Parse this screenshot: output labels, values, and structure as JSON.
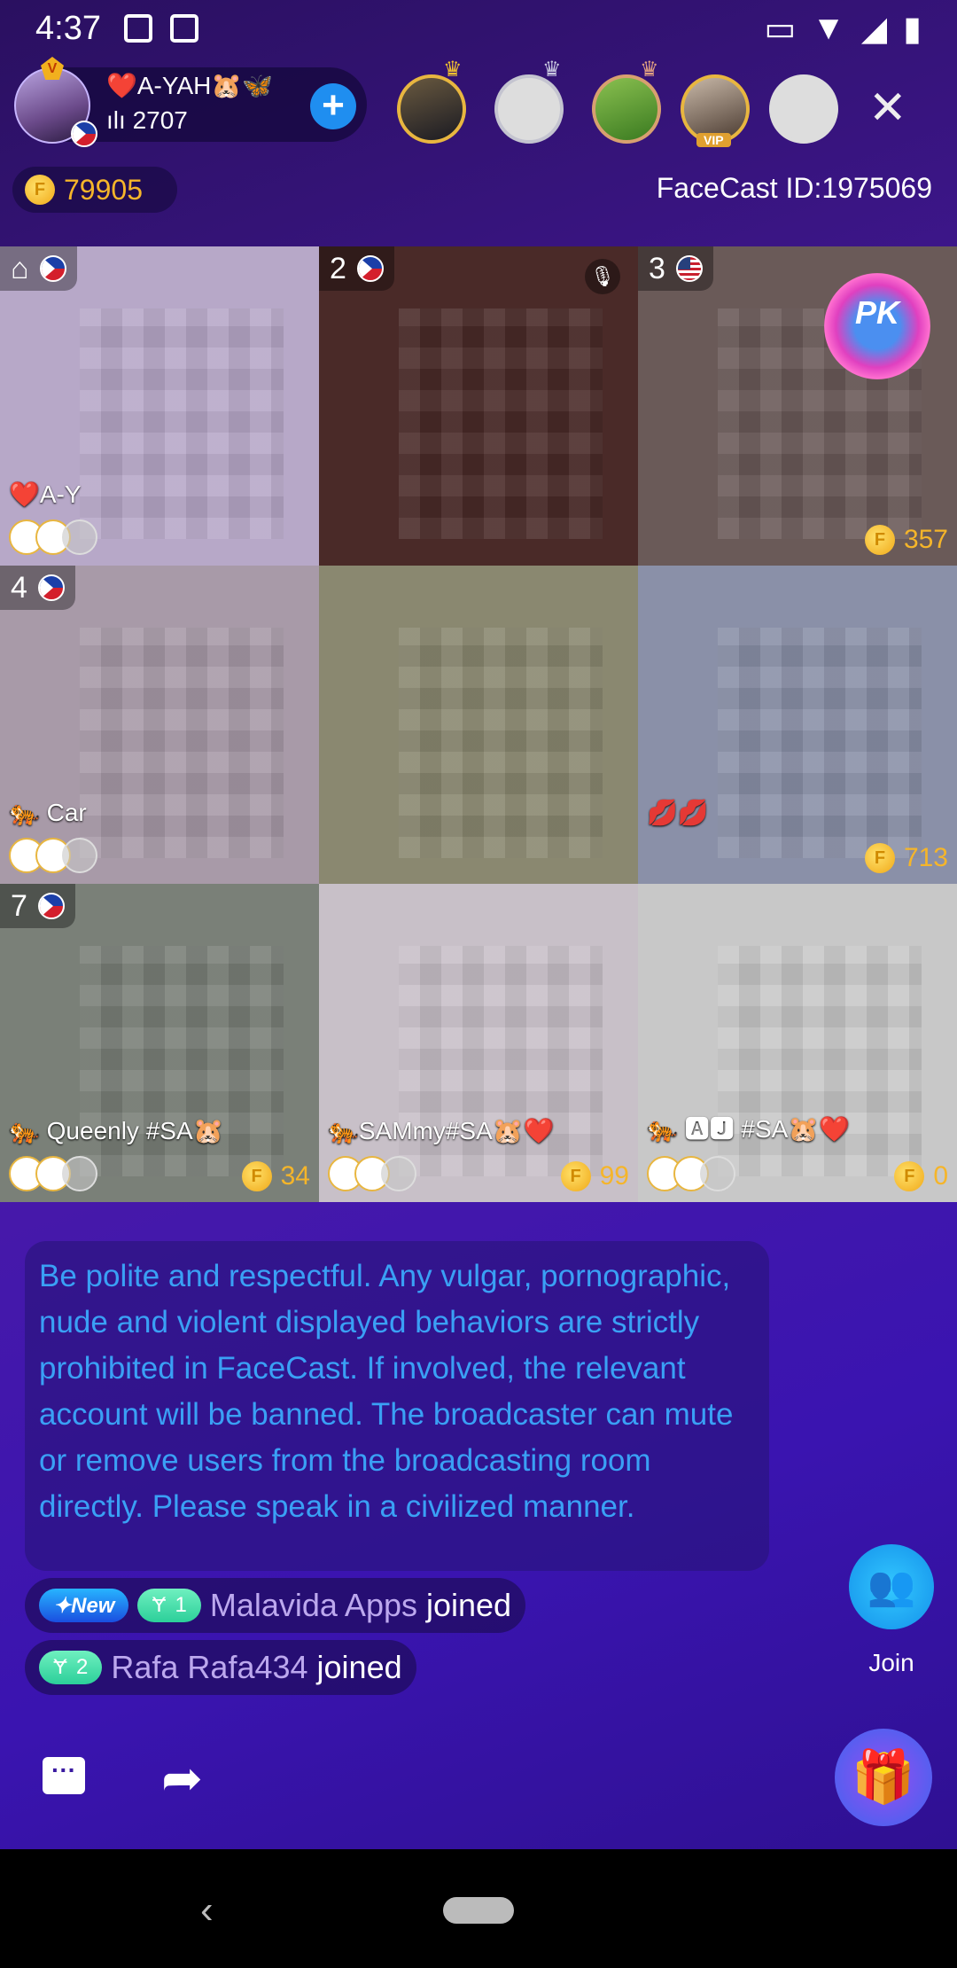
{
  "status_bar": {
    "time": "4:37",
    "icons": [
      "image-icon",
      "screenshot-icon",
      "cast-icon",
      "wifi-icon",
      "signal-icon",
      "battery-icon"
    ]
  },
  "host": {
    "name": "❤️A-YAH🐹🦋",
    "fans": "2707",
    "level_badge": "V",
    "follow_label": "+"
  },
  "viewers": [
    {
      "frame": "gold-crown"
    },
    {
      "frame": "silver-crown"
    },
    {
      "frame": "bronze-crown"
    },
    {
      "frame": "vip",
      "badge": "VIP"
    },
    {
      "frame": "none"
    }
  ],
  "close_label": "✕",
  "coins": "79905",
  "facecast_id": "FaceCast ID:1975069",
  "cells": [
    {
      "seat": "",
      "flag": "ph",
      "name": "❤️A-Y",
      "coins": "",
      "bg": "#b7a8c8",
      "host": true
    },
    {
      "seat": "2",
      "flag": "ph",
      "name": "",
      "coins": "",
      "bg": "#4a2a28",
      "muted": true
    },
    {
      "seat": "3",
      "flag": "us",
      "name": "",
      "coins": "357",
      "bg": "#6a5a58",
      "pk": "PK"
    },
    {
      "seat": "4",
      "flag": "ph",
      "name": "🐅 Car",
      "coins": "",
      "bg": "#a89aa8"
    },
    {
      "seat": "",
      "flag": "",
      "name": "",
      "coins": "",
      "bg": "#8a8870"
    },
    {
      "seat": "",
      "flag": "",
      "name": "💋💋",
      "coins": "713",
      "bg": "#8a90a8"
    },
    {
      "seat": "7",
      "flag": "ph",
      "name": "🐅 Queenly #SA🐹",
      "coins": "34",
      "bg": "#7a8078"
    },
    {
      "seat": "",
      "flag": "",
      "name": "🐅SAMmy#SA🐹❤️",
      "coins": "99",
      "bg": "#c8c0c8"
    },
    {
      "seat": "",
      "flag": "",
      "name": "🐅 🅰🅹 #SA🐹❤️",
      "coins": "0",
      "bg": "#c8c8c8"
    }
  ],
  "rules_text": "Be polite and respectful. Any vulgar, pornographic, nude and violent displayed behaviors are strictly prohibited in FaceCast. If involved, the relevant account will be banned. The broadcaster can mute or remove users from the broadcasting room directly. Please speak in a civilized manner.",
  "chat": [
    {
      "new_tag": "✦New",
      "level": "1",
      "user": "Malavida Apps",
      "action": "joined"
    },
    {
      "level": "2",
      "user": "Rafa Rafa434",
      "action": "joined"
    }
  ],
  "join_label": "Join",
  "colors": {
    "accent": "#1f8ef0",
    "coin": "#f5b52a",
    "rules": "#3aa0f5"
  }
}
